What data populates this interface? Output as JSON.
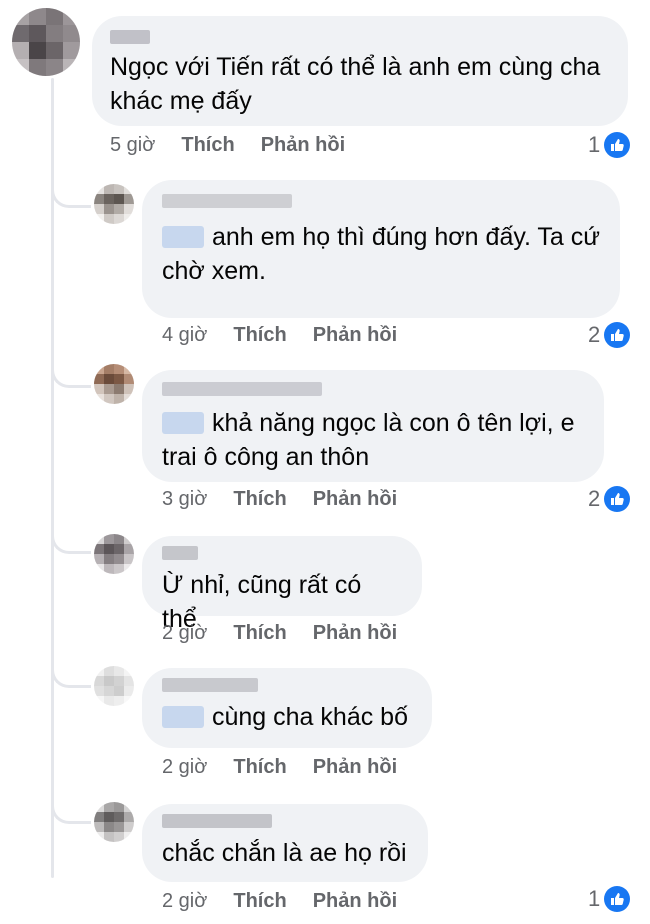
{
  "comments": [
    {
      "author": "",
      "text": "Ngọc với Tiến rất có thể là anh em cùng cha khác mẹ đấy",
      "time": "5 giờ",
      "like_label": "Thích",
      "reply_label": "Phản hồi",
      "reactions": "1"
    },
    {
      "author": "",
      "text": "anh em họ thì đúng hơn đấy. Ta cứ chờ xem.",
      "time": "4 giờ",
      "like_label": "Thích",
      "reply_label": "Phản hồi",
      "reactions": "2"
    },
    {
      "author": "",
      "text": "khả năng ngọc là con ô tên lợi, e trai ô công an thôn",
      "time": "3 giờ",
      "like_label": "Thích",
      "reply_label": "Phản hồi",
      "reactions": "2"
    },
    {
      "author": "",
      "text": "Ừ nhỉ, cũng rất có thể",
      "time": "2 giờ",
      "like_label": "Thích",
      "reply_label": "Phản hồi",
      "reactions": ""
    },
    {
      "author": "",
      "text": "cùng cha khác bố",
      "time": "2 giờ",
      "like_label": "Thích",
      "reply_label": "Phản hồi",
      "reactions": ""
    },
    {
      "author": "",
      "text": "chắc chắn là ae họ rồi",
      "time": "2 giờ",
      "like_label": "Thích",
      "reply_label": "Phản hồi",
      "reactions": "1"
    }
  ],
  "icons": {
    "reaction": "like-thumbs-up-icon"
  },
  "colors": {
    "accent": "#1877f2",
    "bubble": "#f0f2f5",
    "meta": "#65676b"
  }
}
